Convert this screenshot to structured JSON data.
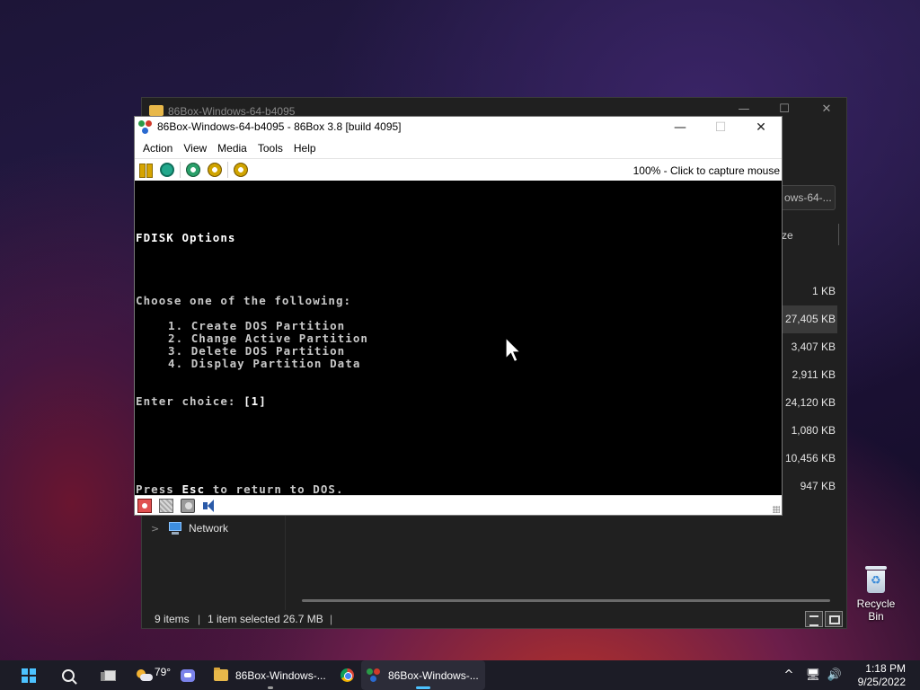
{
  "explorer": {
    "title": "86Box-Windows-64-b4095",
    "search_text": "ows-64-...",
    "size_header": "ze",
    "sizes": [
      "1 KB",
      "27,405 KB",
      "3,407 KB",
      "2,911 KB",
      "24,120 KB",
      "1,080 KB",
      "10,456 KB",
      "947 KB"
    ],
    "selected_index": 1,
    "nav": {
      "network_label": "Network"
    },
    "status": {
      "items": "9 items",
      "selected": "1 item selected  26.7 MB"
    },
    "controls": {
      "minimize": "—",
      "maximize": "☐",
      "close": "✕"
    }
  },
  "box86": {
    "title": "86Box-Windows-64-b4095 - 86Box 3.8 [build 4095]",
    "controls": {
      "minimize": "—",
      "maximize": "☐",
      "close": "✕"
    },
    "menu": [
      "Action",
      "View",
      "Media",
      "Tools",
      "Help"
    ],
    "capture_text": "100% - Click to capture mouse",
    "screen": {
      "heading": "FDISK Options",
      "prompt": "Choose one of the following:",
      "options": [
        "1. Create DOS Partition",
        "2. Change Active Partition",
        "3. Delete DOS Partition",
        "4. Display Partition Data"
      ],
      "choice_label": "Enter choice: ",
      "choice_value": "[1]",
      "footer_pre": "Press ",
      "footer_key": "Esc",
      "footer_post": " to return to DOS."
    }
  },
  "desktop": {
    "recycle_bin_label": "Recycle Bin"
  },
  "taskbar": {
    "weather_temp": "79°",
    "explorer_label": "86Box-Windows-...",
    "box_label": "86Box-Windows-...",
    "tray": {
      "chevron": "^",
      "network": "🖥",
      "volume": "🔊"
    },
    "time": "1:18 PM",
    "date": "9/25/2022"
  },
  "colors": {
    "screen_bg": "#000000",
    "screen_text": "#c8c8c8",
    "accent": "#4cc2ff",
    "taskbar_bg": "#1c1c26"
  }
}
